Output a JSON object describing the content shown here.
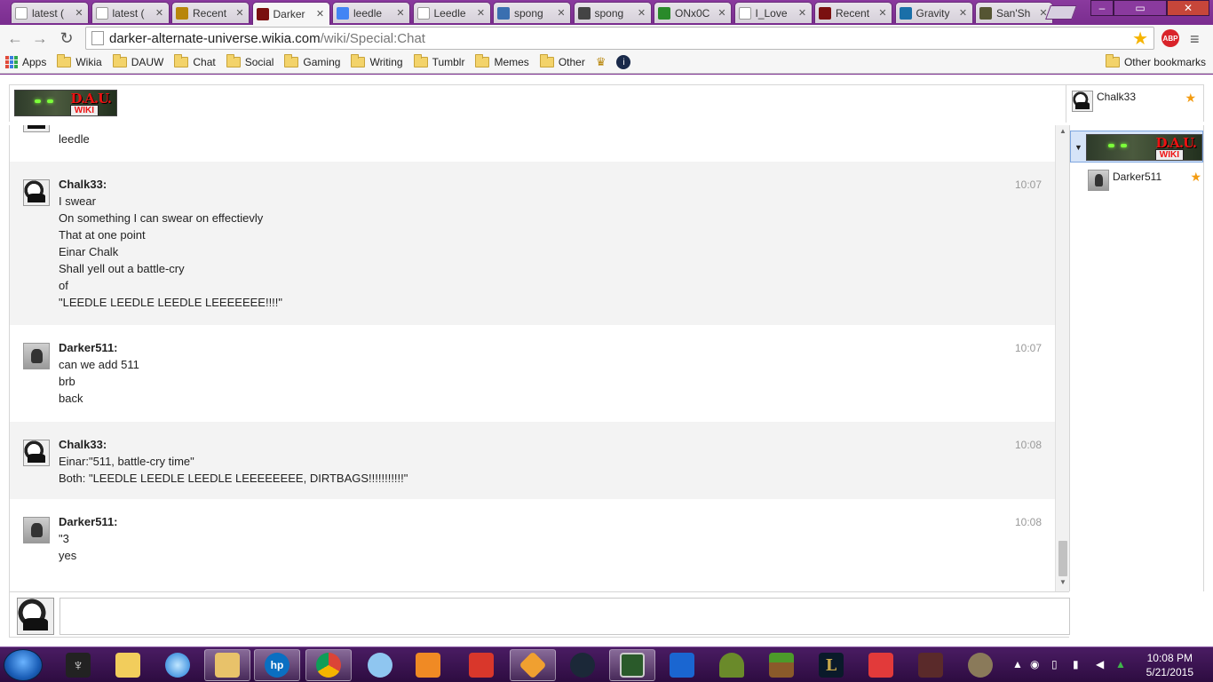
{
  "browser": {
    "tabs": [
      {
        "label": "latest (",
        "icon": "page-icon"
      },
      {
        "label": "latest (",
        "icon": "page-icon"
      },
      {
        "label": "Recent",
        "icon": "fandom-icon"
      },
      {
        "label": "Darker",
        "icon": "dau-icon",
        "active": true
      },
      {
        "label": "leedle",
        "icon": "google-icon"
      },
      {
        "label": "Leedle",
        "icon": "page-icon"
      },
      {
        "label": "spong",
        "icon": "image-icon"
      },
      {
        "label": "spong",
        "icon": "camera-icon"
      },
      {
        "label": "ONx0C",
        "icon": "app-icon"
      },
      {
        "label": "I_Love",
        "icon": "page-icon"
      },
      {
        "label": "Recent",
        "icon": "dau-icon"
      },
      {
        "label": "Gravity",
        "icon": "gravity-icon"
      },
      {
        "label": "San'Sh",
        "icon": "avatar-icon"
      }
    ],
    "url_domain": "darker-alternate-universe.wikia.com",
    "url_path": "/wiki/Special:Chat",
    "abp_label": "ABP",
    "bookmarks": [
      "Apps",
      "Wikia",
      "DAUW",
      "Chat",
      "Social",
      "Gaming",
      "Writing",
      "Tumblr",
      "Memes",
      "Other"
    ],
    "other_bookmarks": "Other bookmarks"
  },
  "chat": {
    "wiki_logo_title": "D.A.U.",
    "wiki_logo_sub": "WIKI",
    "header_user": "Chalk33",
    "partial_message": {
      "line": "leedle"
    },
    "messages": [
      {
        "user": "Chalk33:",
        "time": "10:07",
        "avatar": "chalk",
        "lines": [
          "I swear",
          "On something I can swear on effectievly",
          "That at one point",
          "Einar Chalk",
          "Shall yell out a battle-cry",
          "of",
          "\"LEEDLE LEEDLE LEEDLE LEEEEEEE!!!!\""
        ]
      },
      {
        "user": "Darker511:",
        "time": "10:07",
        "avatar": "darker",
        "lines": [
          "can we add 511",
          "brb",
          "back"
        ]
      },
      {
        "user": "Chalk33:",
        "time": "10:08",
        "avatar": "chalk",
        "lines": [
          "Einar:\"511, battle-cry time\"",
          "Both: \"LEEDLE LEEDLE LEEDLE LEEEEEEEE, DIRTBAGS!!!!!!!!!!!\""
        ]
      },
      {
        "user": "Darker511:",
        "time": "10:08",
        "avatar": "darker",
        "lines": [
          "\"3",
          "yes"
        ]
      }
    ],
    "userlist": [
      "Darker511"
    ]
  },
  "taskbar": {
    "time": "10:08 PM",
    "date": "5/21/2015"
  },
  "colors": {
    "accent": "#7b2d8e",
    "taskbar": "#3b1350",
    "selected_room": "#d6e4f8",
    "mod_star": "#f39c12"
  }
}
